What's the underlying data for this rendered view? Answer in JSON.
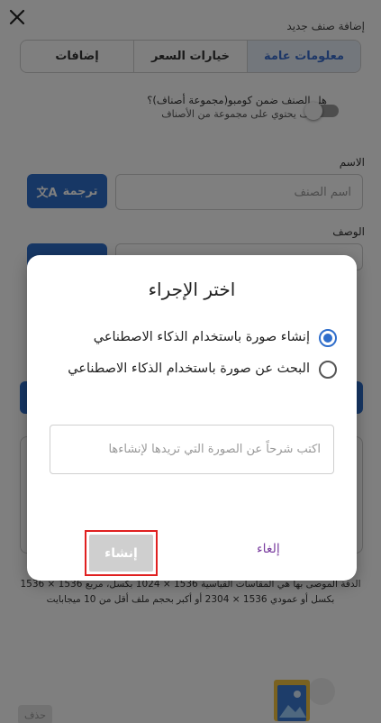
{
  "page": {
    "title": "إضافة صنف جديد",
    "tabs": [
      {
        "label": "معلومات عامة",
        "active": true
      },
      {
        "label": "خيارات السعر",
        "active": false
      },
      {
        "label": "إضافات",
        "active": false
      }
    ],
    "combo_question": "هل الصنف ضمن كومبو(مجموعة أصناف)؟",
    "combo_hint": "الصنف يحتوي على مجموعة من الأصناف",
    "name_label": "الاسم",
    "name_placeholder": "اسم الصنف",
    "translate_label": "ترجمة",
    "desc_label": "الوصف",
    "image_note": "الدقة الموصى بها هي المقاسات القياسية 1536 × 1024 بكسل، مربع 1536 × 1536 بكسل أو عمودي 1536 × 2304 أو أكبر بحجم ملف أقل من 10 ميجابايت",
    "delete_label": "حذف"
  },
  "dialog": {
    "title": "اختر الإجراء",
    "options": [
      {
        "label": "إنشاء صورة باستخدام الذكاء الاصطناعي",
        "selected": true
      },
      {
        "label": "البحث عن صورة باستخدام الذكاء الاصطناعي",
        "selected": false
      }
    ],
    "prompt_placeholder": "اكتب شرحاً عن الصورة التي تريدها لإنشاءها",
    "create_label": "إنشاء",
    "cancel_label": "إلغاء"
  },
  "colors": {
    "primary": "#2f6ecb",
    "cancel": "#7b3fa0",
    "highlight_border": "#e02020"
  }
}
